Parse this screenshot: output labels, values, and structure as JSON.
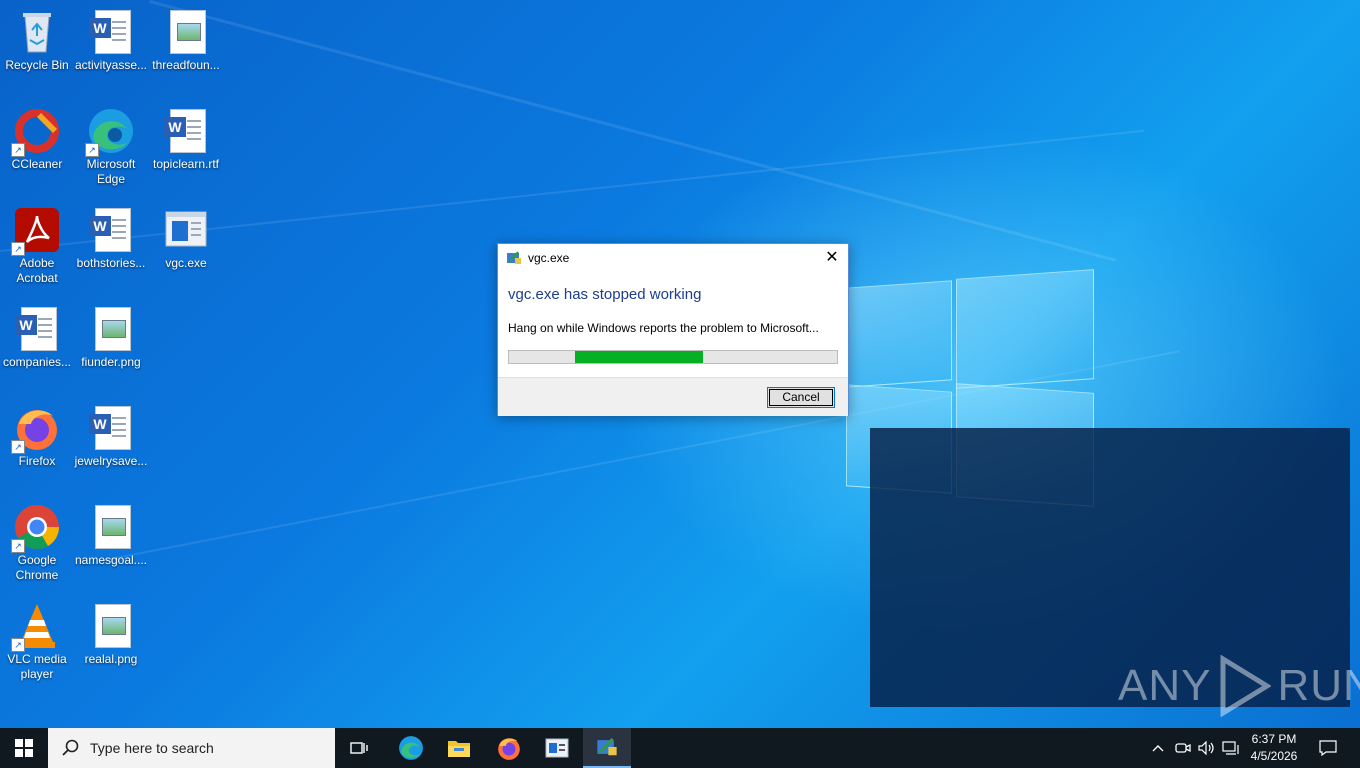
{
  "desktop": {
    "icons": [
      {
        "label": "Recycle Bin",
        "icon": "recycle-bin-icon"
      },
      {
        "label": "activityasse...",
        "icon": "word-document-icon"
      },
      {
        "label": "threadfoun...",
        "icon": "image-file-icon"
      },
      {
        "label": "CCleaner",
        "icon": "ccleaner-icon"
      },
      {
        "label": "Microsoft Edge",
        "icon": "edge-icon"
      },
      {
        "label": "topiclearn.rtf",
        "icon": "word-document-icon"
      },
      {
        "label": "Adobe Acrobat",
        "icon": "acrobat-icon"
      },
      {
        "label": "bothstories...",
        "icon": "word-document-icon"
      },
      {
        "label": "vgc.exe",
        "icon": "exe-icon"
      },
      {
        "label": "companies...",
        "icon": "word-document-icon"
      },
      {
        "label": "fiunder.png",
        "icon": "image-file-icon"
      },
      {
        "label": "Firefox",
        "icon": "firefox-icon"
      },
      {
        "label": "jewelrysave...",
        "icon": "word-document-icon"
      },
      {
        "label": "Google Chrome",
        "icon": "chrome-icon"
      },
      {
        "label": "namesgoal....",
        "icon": "image-file-icon"
      },
      {
        "label": "VLC media player",
        "icon": "vlc-icon"
      },
      {
        "label": "realal.png",
        "icon": "image-file-icon"
      }
    ]
  },
  "dialog": {
    "title": "vgc.exe",
    "heading": "vgc.exe has stopped working",
    "message": "Hang on while Windows reports the problem to Microsoft...",
    "progress_fraction_start": 0.2,
    "progress_fraction_end": 0.59,
    "cancel_label": "Cancel",
    "close_glyph": "✕"
  },
  "taskbar": {
    "search_placeholder": "Type here to search",
    "time": "6:37 PM",
    "date": "4/5/2026"
  },
  "watermark": {
    "text_left": "ANY",
    "text_right": "RUN"
  },
  "colors": {
    "accent": "#0078d7",
    "progress_green": "#06b025",
    "heading_blue": "#1e3d8f",
    "taskbar": "#101820"
  }
}
